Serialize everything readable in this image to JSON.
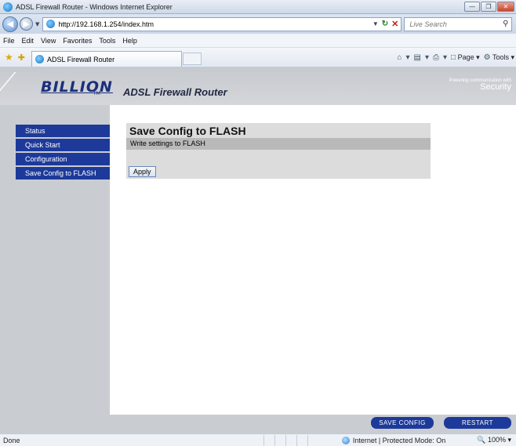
{
  "window": {
    "title": "ADSL Firewall Router - Windows Internet Explorer"
  },
  "address": {
    "url": "http://192.168.1.254/index.htm",
    "search_placeholder": "Live Search"
  },
  "menu": [
    "File",
    "Edit",
    "View",
    "Favorites",
    "Tools",
    "Help"
  ],
  "tab": {
    "label": "ADSL Firewall Router"
  },
  "command_bar": {
    "page_label": "Page",
    "tools_label": "Tools"
  },
  "header": {
    "logo": "BILLION",
    "tm": "TM",
    "product": "ADSL Firewall Router",
    "powering_top": "Powering communication with",
    "powering_bottom": "Security"
  },
  "sidebar": {
    "items": [
      {
        "label": "Status"
      },
      {
        "label": "Quick Start"
      },
      {
        "label": "Configuration"
      },
      {
        "label": "Save Config to FLASH"
      }
    ]
  },
  "panel": {
    "title": "Save Config to FLASH",
    "subtitle": "Write settings to FLASH",
    "apply_label": "Apply"
  },
  "footer": {
    "save_label": "SAVE CONFIG",
    "restart_label": "RESTART"
  },
  "status": {
    "text": "Done",
    "zone": "Internet | Protected Mode: On",
    "zoom": "100%"
  }
}
